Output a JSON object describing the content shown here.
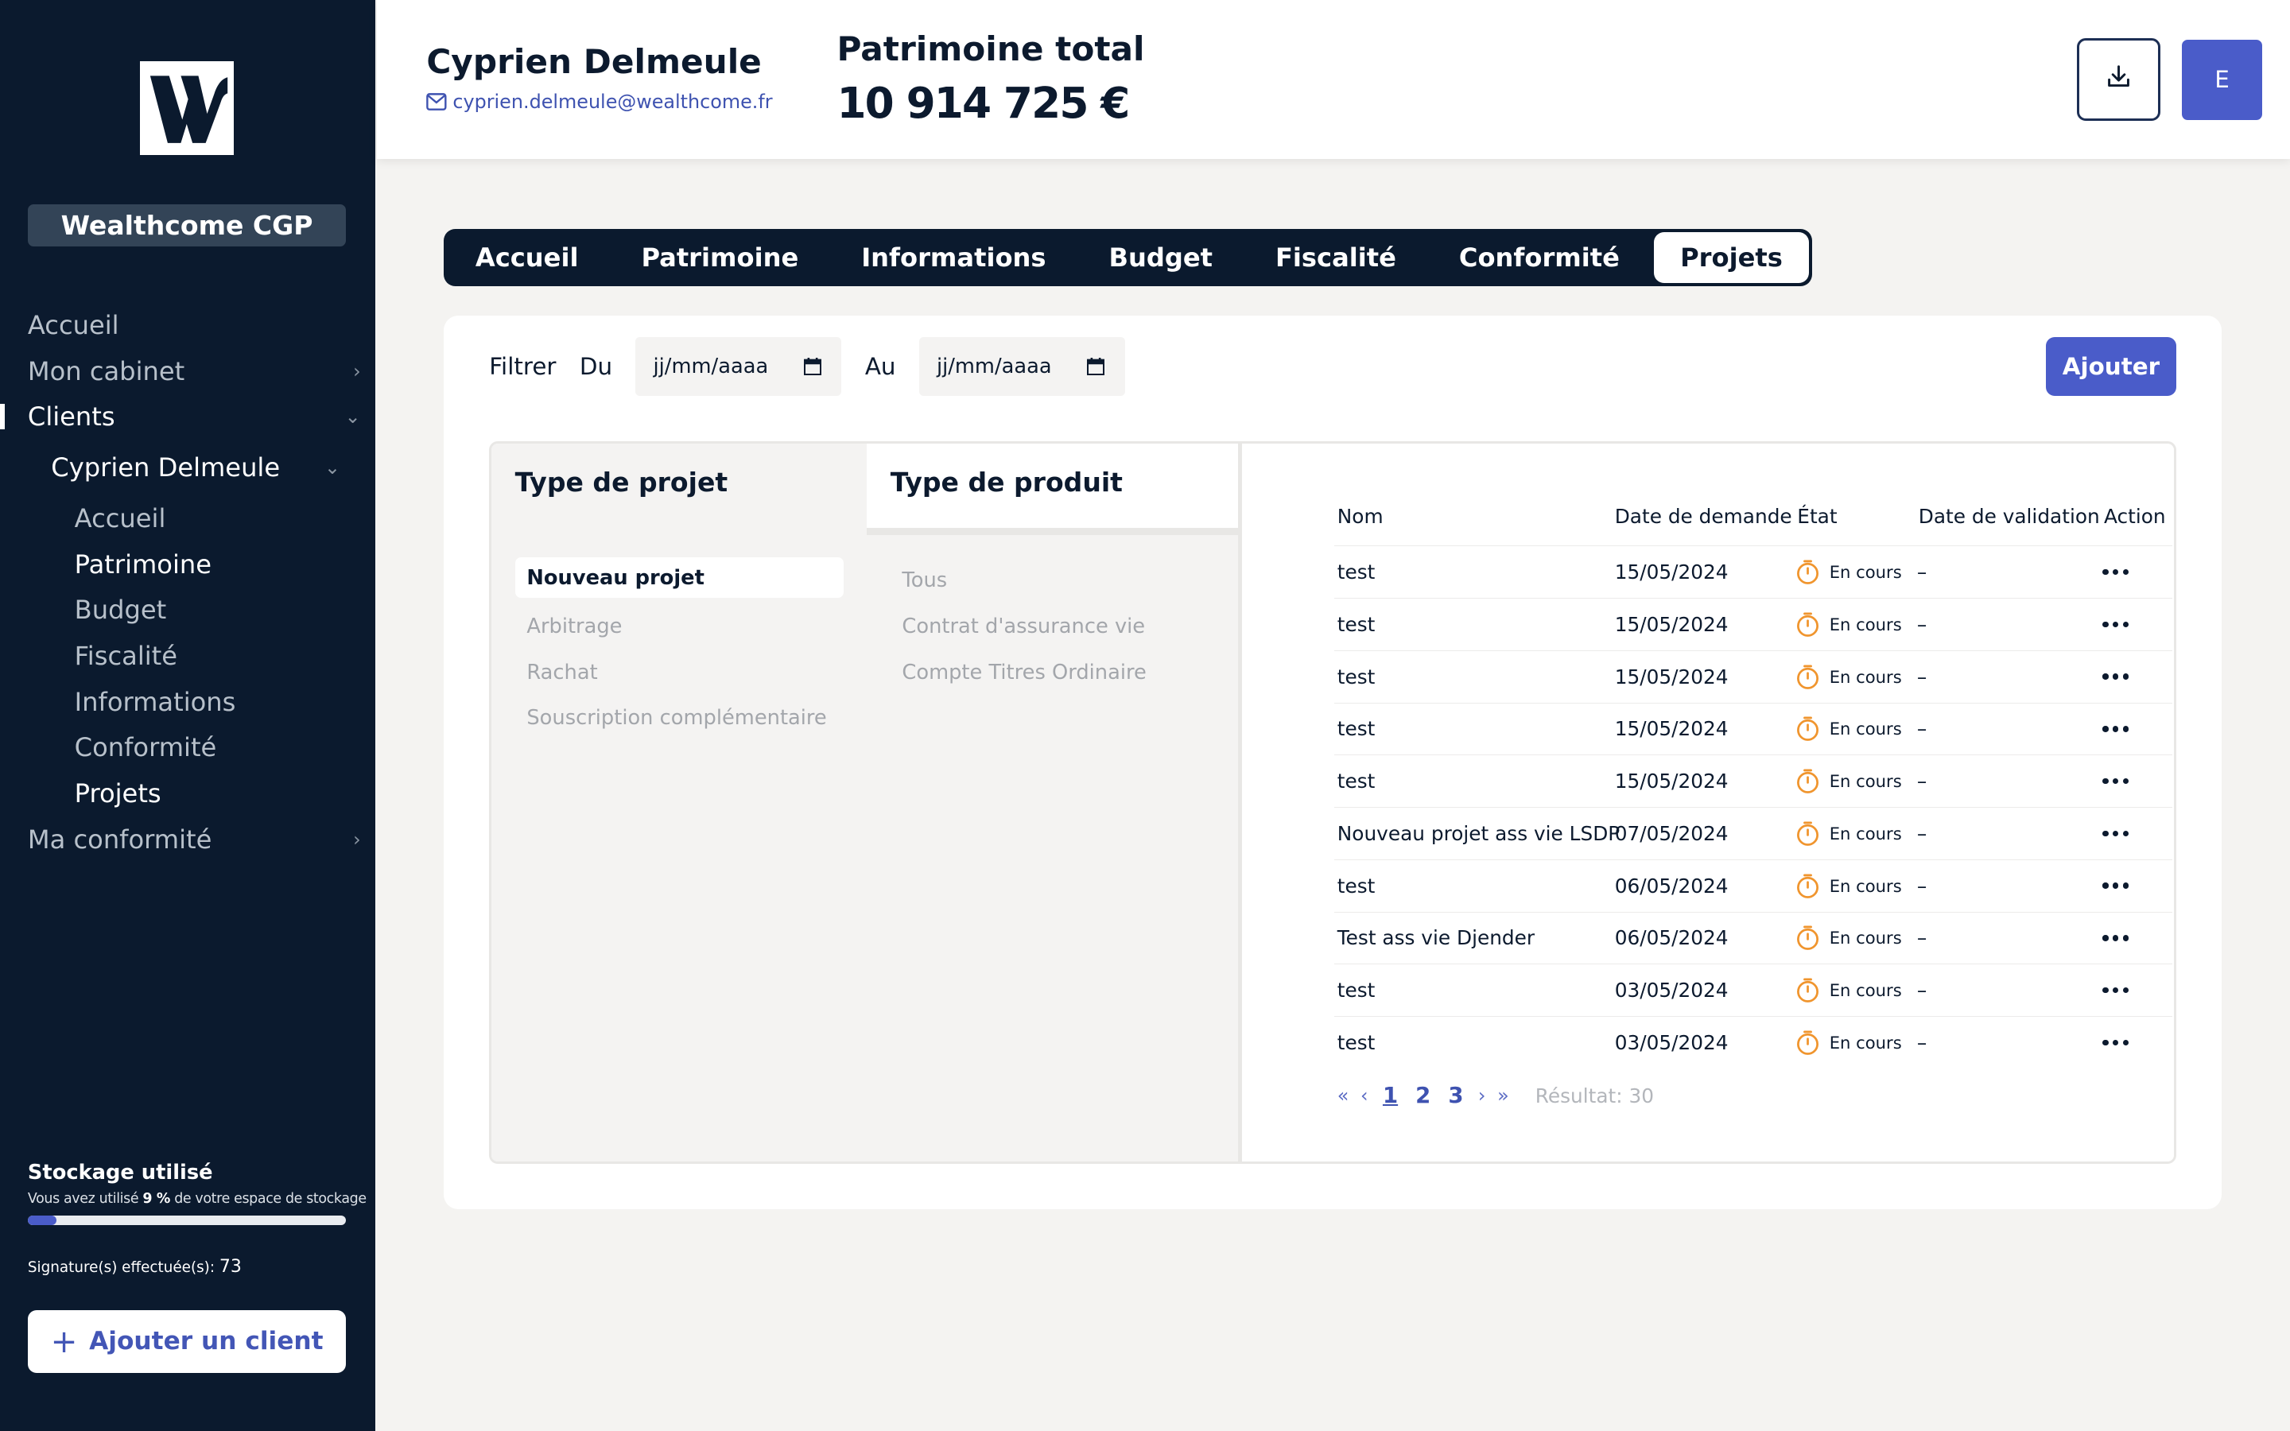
{
  "sidebar": {
    "logo_icon": "wealthcome-w-logo",
    "org_name": "Wealthcome CGP",
    "nav": {
      "accueil": "Accueil",
      "mon_cabinet": "Mon cabinet",
      "clients": "Clients",
      "client_name": "Cyprien Delmeule",
      "sub_accueil": "Accueil",
      "sub_patrimoine": "Patrimoine",
      "sub_budget": "Budget",
      "sub_fiscalite": "Fiscalité",
      "sub_informations": "Informations",
      "sub_conformite": "Conformité",
      "sub_projets": "Projets",
      "ma_conformite": "Ma conformité"
    },
    "storage": {
      "title": "Stockage utilisé",
      "prefix": "Vous avez utilisé",
      "percent_label": "9 %",
      "suffix": "de votre espace de stockage",
      "percent_value": 9
    },
    "signatures": {
      "label": "Signature(s) effectuée(s):",
      "count": "73"
    },
    "add_client_label": "Ajouter un client"
  },
  "header": {
    "client_name": "Cyprien Delmeule",
    "client_email": "cyprien.delmeule@wealthcome.fr",
    "total_label": "Patrimoine total",
    "total_value": "10 914 725 €",
    "avatar_letter": "E"
  },
  "tabs": [
    "Accueil",
    "Patrimoine",
    "Informations",
    "Budget",
    "Fiscalité",
    "Conformité",
    "Projets"
  ],
  "active_tab": "Projets",
  "filter": {
    "label": "Filtrer",
    "from_label": "Du",
    "from_value": "jj/mm/aaaa",
    "to_label": "Au",
    "to_value": "jj/mm/aaaa",
    "add_label": "Ajouter"
  },
  "project_types": {
    "title": "Type de projet",
    "items": [
      "Nouveau projet",
      "Arbitrage",
      "Rachat",
      "Souscription complémentaire"
    ],
    "selected": "Nouveau projet"
  },
  "product_types": {
    "title": "Type de produit",
    "items": [
      "Tous",
      "Contrat d'assurance vie",
      "Compte Titres Ordinaire"
    ]
  },
  "table": {
    "columns": {
      "nom": "Nom",
      "date": "Date de demande",
      "etat": "État",
      "validation": "Date de validation",
      "action": "Action"
    },
    "rows": [
      {
        "nom": "test",
        "date": "15/05/2024",
        "etat": "En cours",
        "validation": "–"
      },
      {
        "nom": "test",
        "date": "15/05/2024",
        "etat": "En cours",
        "validation": "–"
      },
      {
        "nom": "test",
        "date": "15/05/2024",
        "etat": "En cours",
        "validation": "–"
      },
      {
        "nom": "test",
        "date": "15/05/2024",
        "etat": "En cours",
        "validation": "–"
      },
      {
        "nom": "test",
        "date": "15/05/2024",
        "etat": "En cours",
        "validation": "–"
      },
      {
        "nom": "Nouveau projet ass vie LSDP",
        "date": "07/05/2024",
        "etat": "En cours",
        "validation": "–"
      },
      {
        "nom": "test",
        "date": "06/05/2024",
        "etat": "En cours",
        "validation": "–"
      },
      {
        "nom": "Test ass vie Djender",
        "date": "06/05/2024",
        "etat": "En cours",
        "validation": "–"
      },
      {
        "nom": "test",
        "date": "03/05/2024",
        "etat": "En cours",
        "validation": "–"
      },
      {
        "nom": "test",
        "date": "03/05/2024",
        "etat": "En cours",
        "validation": "–"
      }
    ],
    "status_color": "#f0952e"
  },
  "pagination": {
    "first": "«",
    "prev": "‹",
    "pages": [
      "1",
      "2",
      "3"
    ],
    "current": "1",
    "next": "›",
    "last": "»",
    "result": "Résultat: 30"
  },
  "colors": {
    "sidebar_bg": "#0b1a2e",
    "accent": "#4a5cc9",
    "status": "#f0952e"
  }
}
